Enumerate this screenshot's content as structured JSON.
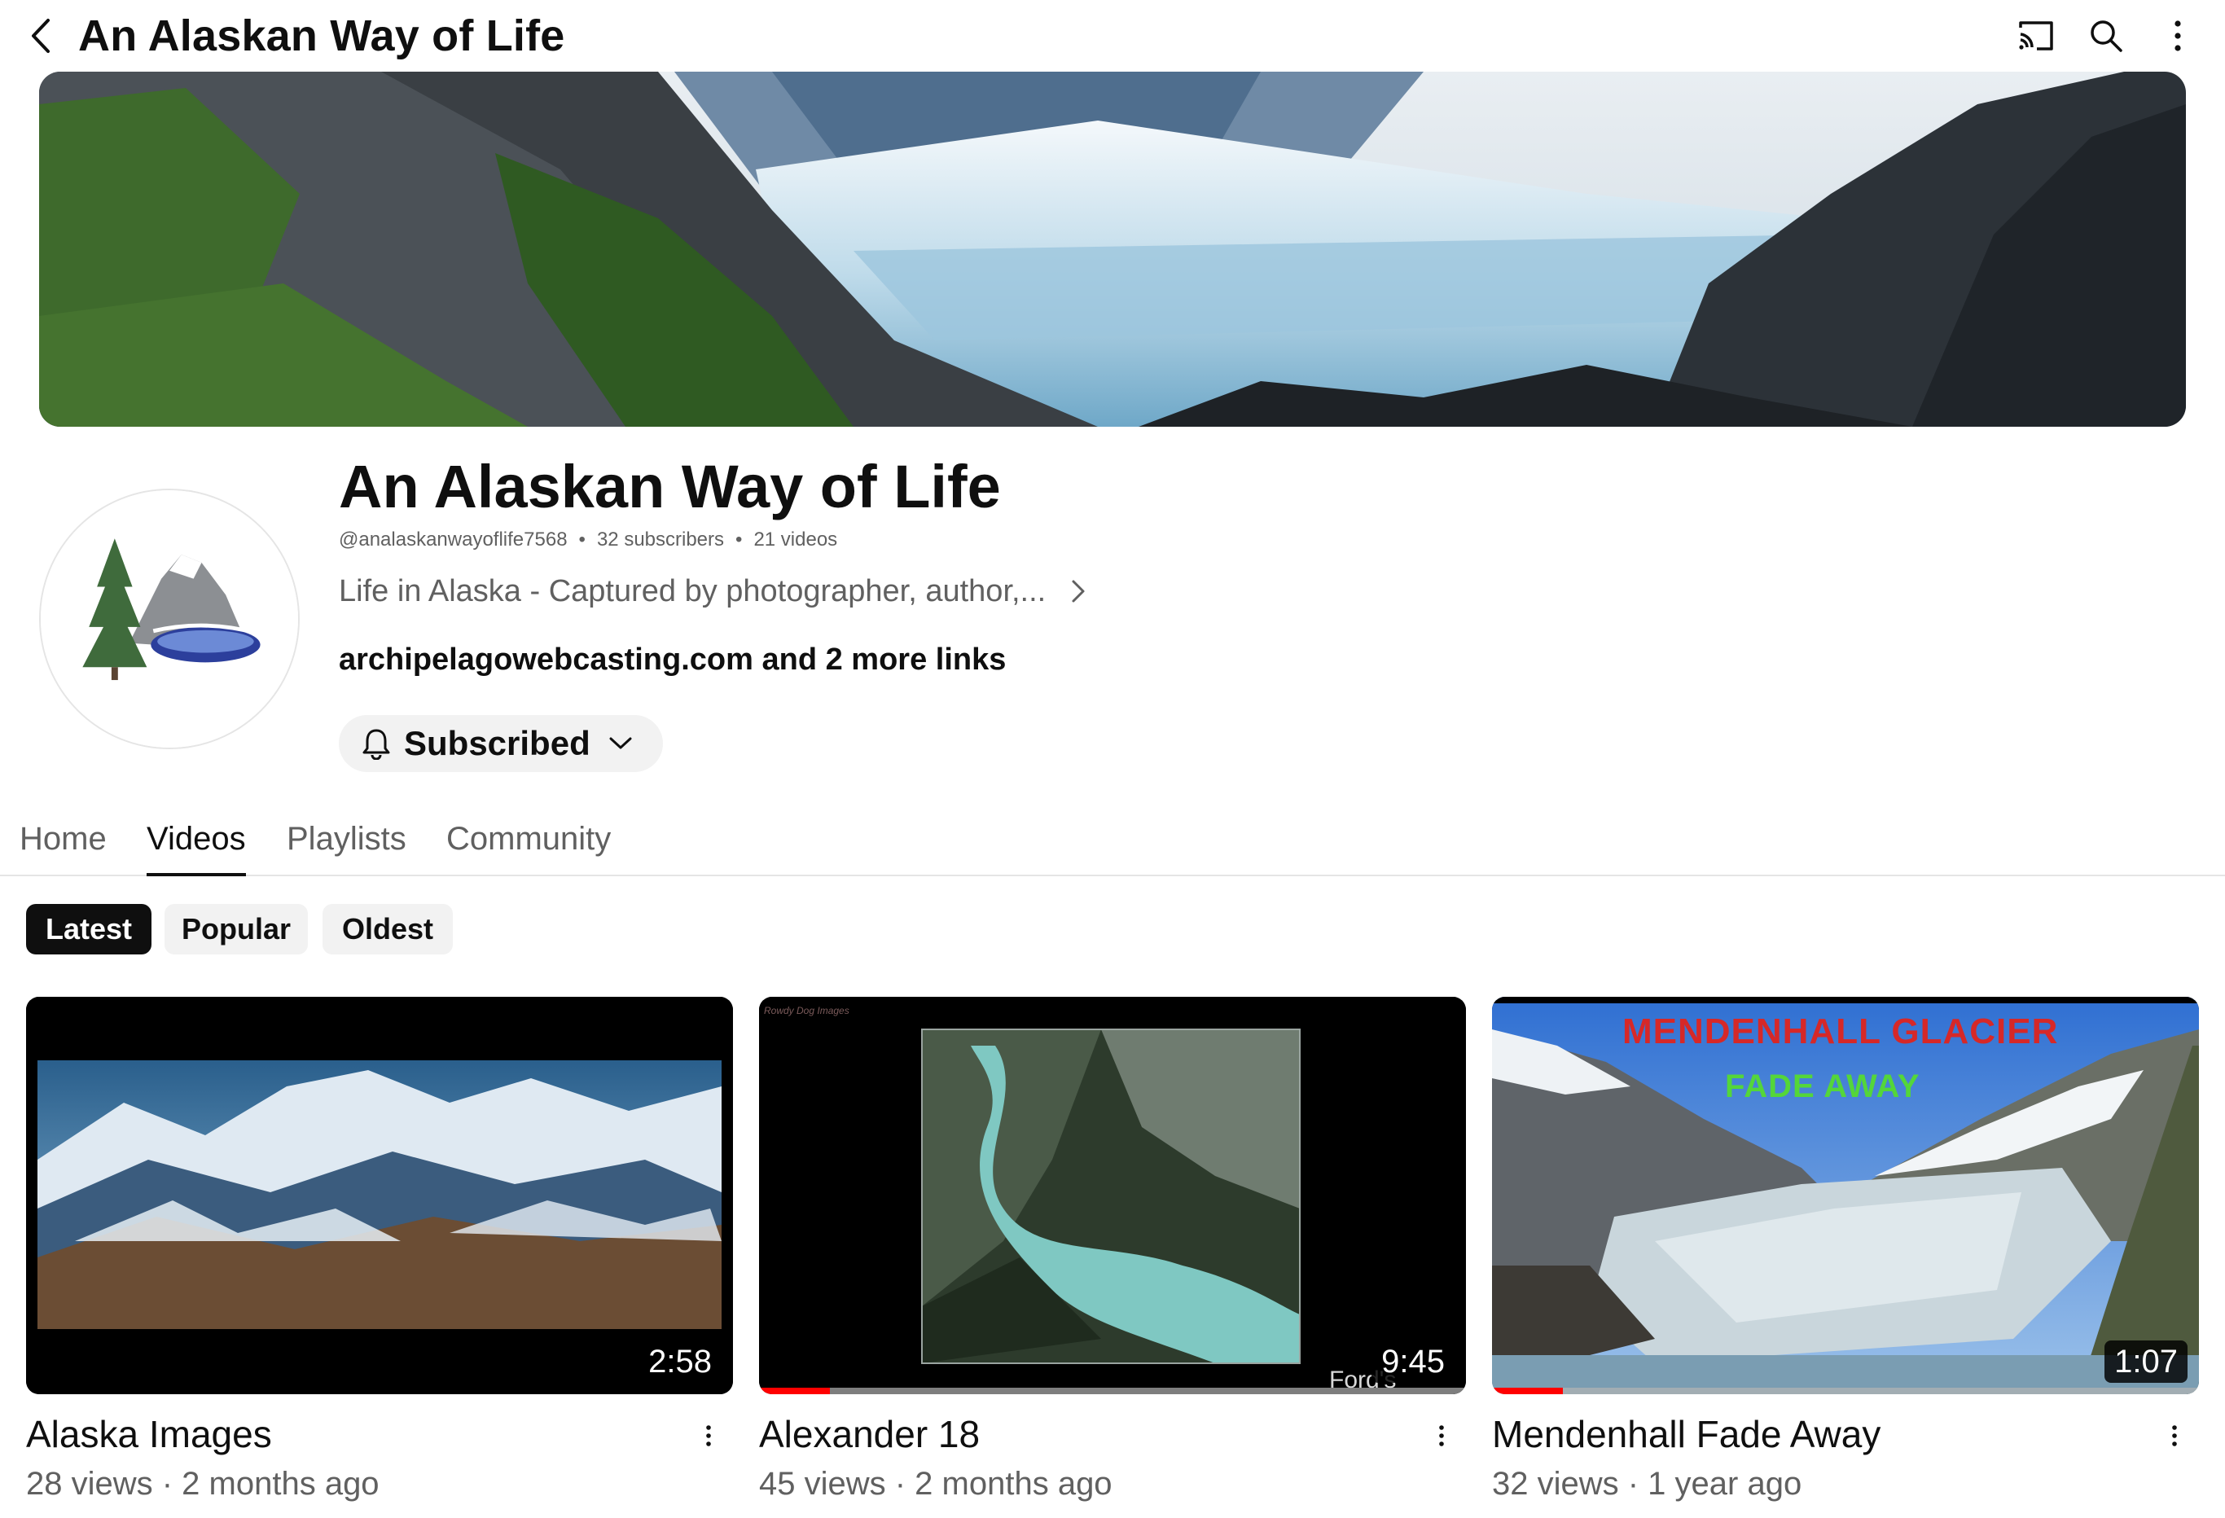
{
  "topbar": {
    "title": "An Alaskan Way of Life",
    "icons": [
      "back-icon",
      "cast-icon",
      "search-icon",
      "more-vert-icon"
    ]
  },
  "channel": {
    "name": "An Alaskan Way of Life",
    "handle": "@analaskanwayoflife7568",
    "subscribers": "32 subscribers",
    "videos_count": "21 videos",
    "separator": "•",
    "description": "Life in Alaska - Captured by photographer, author,...",
    "links": "archipelagowebcasting.com and 2 more links",
    "subscribe_label": "Subscribed"
  },
  "tabs": [
    {
      "label": "Home",
      "active": false
    },
    {
      "label": "Videos",
      "active": true
    },
    {
      "label": "Playlists",
      "active": false
    },
    {
      "label": "Community",
      "active": false
    }
  ],
  "chips": [
    {
      "label": "Latest",
      "active": true
    },
    {
      "label": "Popular",
      "active": false
    },
    {
      "label": "Oldest",
      "active": false
    }
  ],
  "videos": [
    {
      "title": "Alaska Images",
      "meta": "28 views · 2 months ago",
      "duration": "2:58",
      "watched_fraction": 0
    },
    {
      "title": "Alexander 18",
      "meta": "45 views · 2 months ago",
      "duration": "9:45",
      "watched_fraction": 0.1,
      "overlay_text": "Ford's Terror",
      "corner_text": "Rowdy Dog Images"
    },
    {
      "title": "Mendenhall Fade Away",
      "meta": "32 views · 1 year ago",
      "duration": "1:07",
      "watched_fraction": 0.1,
      "thumb_text_1": "MENDENHALL GLACIER",
      "thumb_text_2": "FADE AWAY"
    }
  ],
  "colors": {
    "text_primary": "#0f0f0f",
    "text_secondary": "#606060",
    "chip_bg": "#f2f2f2",
    "progress_red": "#ff0000"
  }
}
